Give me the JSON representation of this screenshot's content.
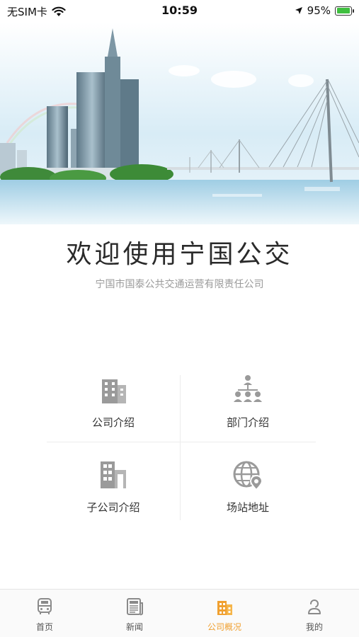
{
  "status_bar": {
    "carrier": "无SIM卡",
    "time": "10:59",
    "battery": "95%",
    "battery_level": 0.95
  },
  "hero": {
    "image": "city-skyline-and-bridge-illustration"
  },
  "welcome_title": "欢迎使用宁国公交",
  "company_name": "宁国市国泰公共交通运营有限责任公司",
  "menu": [
    {
      "label": "公司介绍",
      "icon": "building-icon"
    },
    {
      "label": "部门介绍",
      "icon": "org-chart-icon"
    },
    {
      "label": "子公司介绍",
      "icon": "subsidiary-building-icon"
    },
    {
      "label": "场站地址",
      "icon": "globe-location-icon"
    }
  ],
  "tabbar": [
    {
      "label": "首页",
      "icon": "bus-icon",
      "active": false
    },
    {
      "label": "新闻",
      "icon": "newspaper-icon",
      "active": false
    },
    {
      "label": "公司概况",
      "icon": "company-building-icon",
      "active": true
    },
    {
      "label": "我的",
      "icon": "user-icon",
      "active": false
    }
  ],
  "colors": {
    "accent": "#f0a030",
    "icon_gray": "#9a9a9a",
    "text_gray": "#9a9a9a"
  }
}
